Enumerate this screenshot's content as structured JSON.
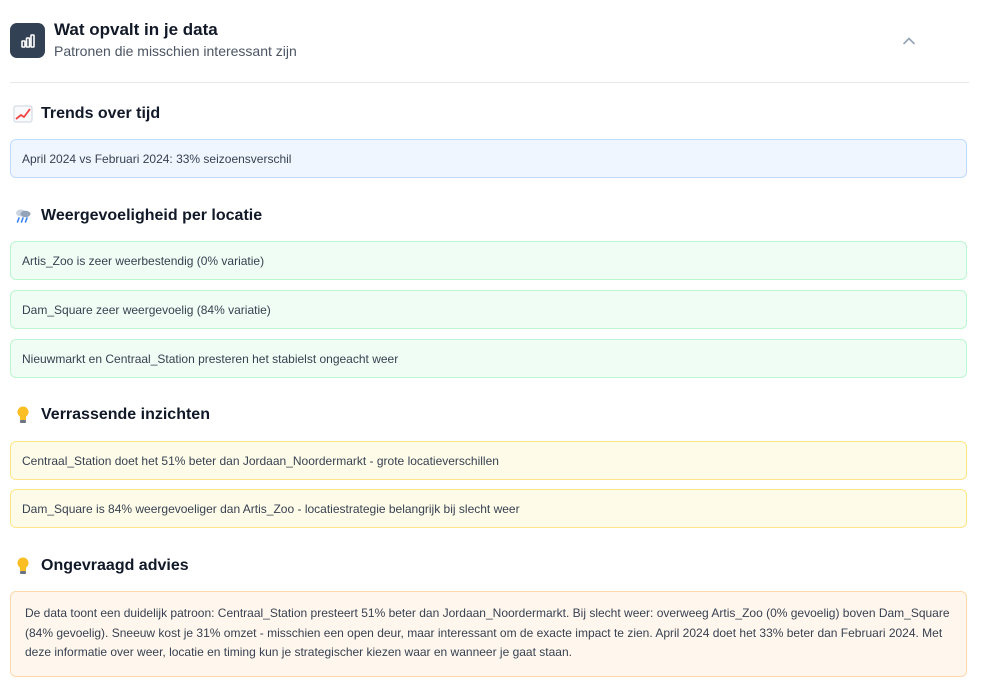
{
  "header": {
    "title": "Wat opvalt in je data",
    "subtitle": "Patronen die misschien interessant zijn",
    "icon": "bar-chart-icon",
    "collapse_icon": "chevron-up-icon"
  },
  "sections": {
    "trends": {
      "title": "Trends over tijd",
      "icon": "chart-increasing-icon",
      "items": [
        "April 2024 vs Februari 2024: 33% seizoensverschil"
      ]
    },
    "weather": {
      "title": "Weergevoeligheid per locatie",
      "icon": "cloud-rain-icon",
      "items": [
        "Artis_Zoo is zeer weerbestendig (0% variatie)",
        "Dam_Square zeer weergevoelig (84% variatie)",
        "Nieuwmarkt en Centraal_Station presteren het stabielst ongeacht weer"
      ]
    },
    "insights": {
      "title": "Verrassende inzichten",
      "icon": "light-bulb-icon",
      "items": [
        "Centraal_Station doet het 51% beter dan Jordaan_Noordermarkt - grote locatieverschillen",
        "Dam_Square is 84% weergevoeliger dan Artis_Zoo - locatiestrategie belangrijk bij slecht weer"
      ]
    },
    "advice": {
      "title": "Ongevraagd advies",
      "icon": "light-bulb-icon",
      "text": "De data toont een duidelijk patroon: Centraal_Station presteert 51% beter dan Jordaan_Noordermarkt. Bij slecht weer: overweeg Artis_Zoo (0% gevoelig) boven Dam_Square (84% gevoelig). Sneeuw kost je 31% omzet - misschien een open deur, maar interessant om de exacte impact te zien. April 2024 doet het 33% beter dan Februari 2024. Met deze informatie over weer, locatie en timing kun je strategischer kiezen waar en wanneer je gaat staan."
    }
  },
  "colors": {
    "icon_bg": "#334155",
    "blue_card": "#eff6ff",
    "green_card": "#f0fdf4",
    "yellow_card": "#fefce8",
    "orange_card": "#fff7ed"
  }
}
